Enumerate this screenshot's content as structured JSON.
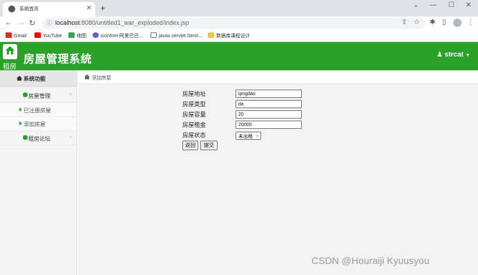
{
  "browser": {
    "tab_title": "系统首页",
    "url_host": "localhost",
    "url_rest": ":8080/untitled1_war_exploded/index.jsp",
    "bookmarks": [
      "Gmail",
      "YouTube",
      "地图",
      "iconfont-阿里巴巴...",
      "javax.servlet.Servl...",
      "数据库课程设计"
    ]
  },
  "header": {
    "logo_caption": "租房",
    "title": "房屋管理系统",
    "user": "strcat"
  },
  "sidebar": {
    "heading": "系统功能",
    "menus": [
      {
        "label": "房屋管理",
        "subitems": [
          "已注册房屋",
          "添加房屋"
        ]
      },
      {
        "label": "租房论坛"
      }
    ]
  },
  "breadcrumb": "添加房屋",
  "form": {
    "fields": [
      {
        "label": "房屋地址",
        "value": "qingdao"
      },
      {
        "label": "房屋类型",
        "value": "da"
      },
      {
        "label": "房屋容量",
        "value": "20"
      },
      {
        "label": "房屋租金",
        "value": "20000"
      }
    ],
    "status_label": "房屋状态",
    "status_value": "未出租",
    "back_button": "返回",
    "submit_button": "提交"
  },
  "watermark": "CSDN @Houraiji Kyuusyou",
  "colors": {
    "header_green": "#2aa22a",
    "sidebar_bg": "#f5f5f5",
    "main_bg": "#f3f3f3"
  }
}
